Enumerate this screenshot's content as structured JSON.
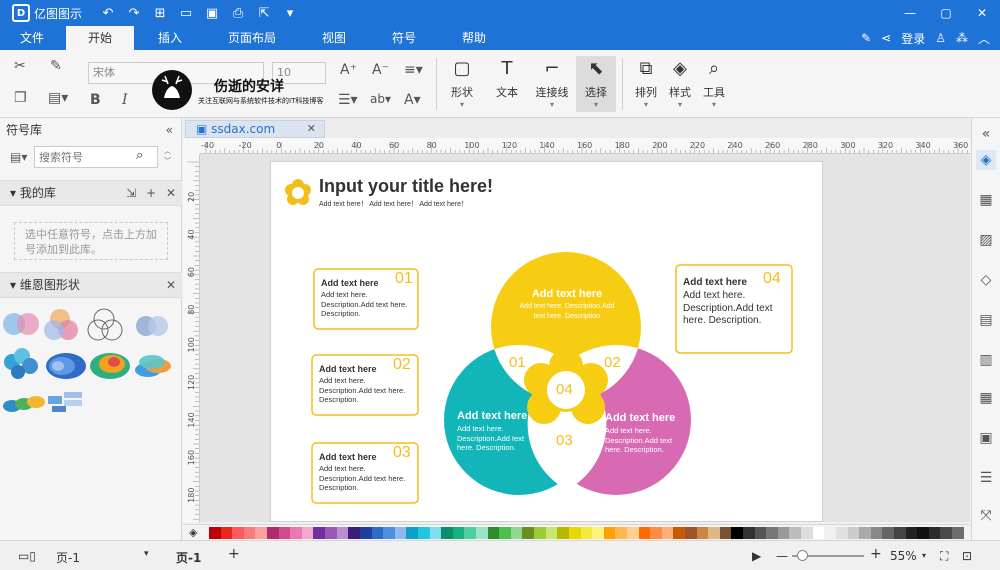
{
  "app": {
    "name": "亿图图示"
  },
  "menu": {
    "tabs": [
      "文件",
      "开始",
      "插入",
      "页面布局",
      "视图",
      "符号",
      "帮助"
    ],
    "active": "开始",
    "login": "登录"
  },
  "ribbon": {
    "font_name": "宋体",
    "font_size": "10",
    "shape_label": "形状",
    "text_label": "文本",
    "connector_label": "连接线",
    "select_label": "选择",
    "arrange_label": "排列",
    "style_label": "样式",
    "tools_label": "工具"
  },
  "watermark": {
    "title": "伤逝的安详",
    "subtitle": "关注互联网与系统软件技术的IT科技博客"
  },
  "left_panel": {
    "title": "符号库",
    "search_placeholder": "搜索符号",
    "my_library": "我的库",
    "drop_hint": "选中任意符号，点击上方加号添加到此库。",
    "venn_section": "维恩图形状"
  },
  "document": {
    "tab_name": "ssdax.com"
  },
  "rulers": {
    "h_ticks": [
      "-40",
      "-20",
      "0",
      "20",
      "40",
      "60",
      "80",
      "100",
      "120",
      "140",
      "160",
      "180",
      "200",
      "220",
      "240",
      "260",
      "280",
      "300",
      "320",
      "340",
      "360"
    ],
    "v_ticks": [
      "20",
      "40",
      "60",
      "80",
      "100",
      "120",
      "140",
      "160",
      "180"
    ]
  },
  "diagram": {
    "title": "Input your title here!",
    "subtitle": "Add text here！ Add text here！ Add text here！",
    "boxes": [
      {
        "num": "01",
        "title": "Add text here",
        "body": "Add text here. Description.Add text here. Description."
      },
      {
        "num": "02",
        "title": "Add text here",
        "body": "Add text here. Description.Add text here. Description."
      },
      {
        "num": "03",
        "title": "Add text here",
        "body": "Add text here. Description.Add text here. Description."
      },
      {
        "num": "04",
        "title": "Add text here",
        "body": "Add text here. Description.Add text here. Description."
      }
    ],
    "circles": {
      "top_title": "Add text here",
      "top_body": "Add text here. Description.Add text here. Description",
      "left_title": "Add text here",
      "left_body": "Add text here. Description.Add text here. Description.",
      "right_title": "Add text here",
      "right_body": "Add text here. Description.Add text here. Description."
    },
    "nums": {
      "n01": "01",
      "n02": "02",
      "n03": "03",
      "n04": "04"
    },
    "colors": {
      "yellow": "#f7cd14",
      "teal": "#12b5b8",
      "pink": "#d86ab4",
      "accent": "#f2bf1a"
    }
  },
  "status": {
    "page_selector": "页-1",
    "page_tab": "页-1",
    "zoom": "55%"
  },
  "icons": [
    "cut-icon",
    "format-painter-icon",
    "copy-icon",
    "paste-icon",
    "bold-icon",
    "italic-icon",
    "rectangle-icon",
    "text-icon",
    "connector-icon",
    "pointer-icon",
    "arrange-icon",
    "fill-icon",
    "tools-icon",
    "search-icon",
    "fill-bucket-icon",
    "play-icon",
    "fullscreen-icon"
  ]
}
